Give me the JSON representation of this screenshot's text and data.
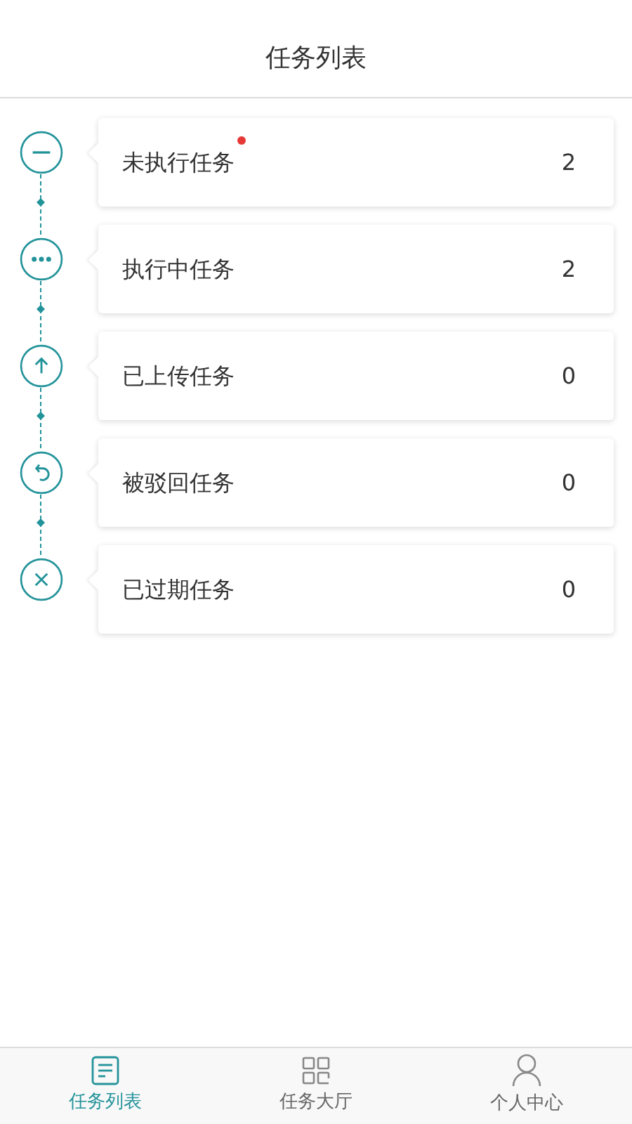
{
  "header": {
    "title": "任务列表"
  },
  "tasks": [
    {
      "kind": "minus",
      "label": "未执行任务",
      "count": "2",
      "unread": true
    },
    {
      "kind": "dots",
      "label": "执行中任务",
      "count": "2",
      "unread": false
    },
    {
      "kind": "up",
      "label": "已上传任务",
      "count": "0",
      "unread": false
    },
    {
      "kind": "undo",
      "label": "被驳回任务",
      "count": "0",
      "unread": false
    },
    {
      "kind": "cross",
      "label": "已过期任务",
      "count": "0",
      "unread": false
    }
  ],
  "tab_bar": [
    {
      "kind": "list",
      "label": "任务列表",
      "selected": true
    },
    {
      "kind": "grid",
      "label": "任务大厅",
      "selected": false
    },
    {
      "kind": "person",
      "label": "个人中心",
      "selected": false
    }
  ]
}
